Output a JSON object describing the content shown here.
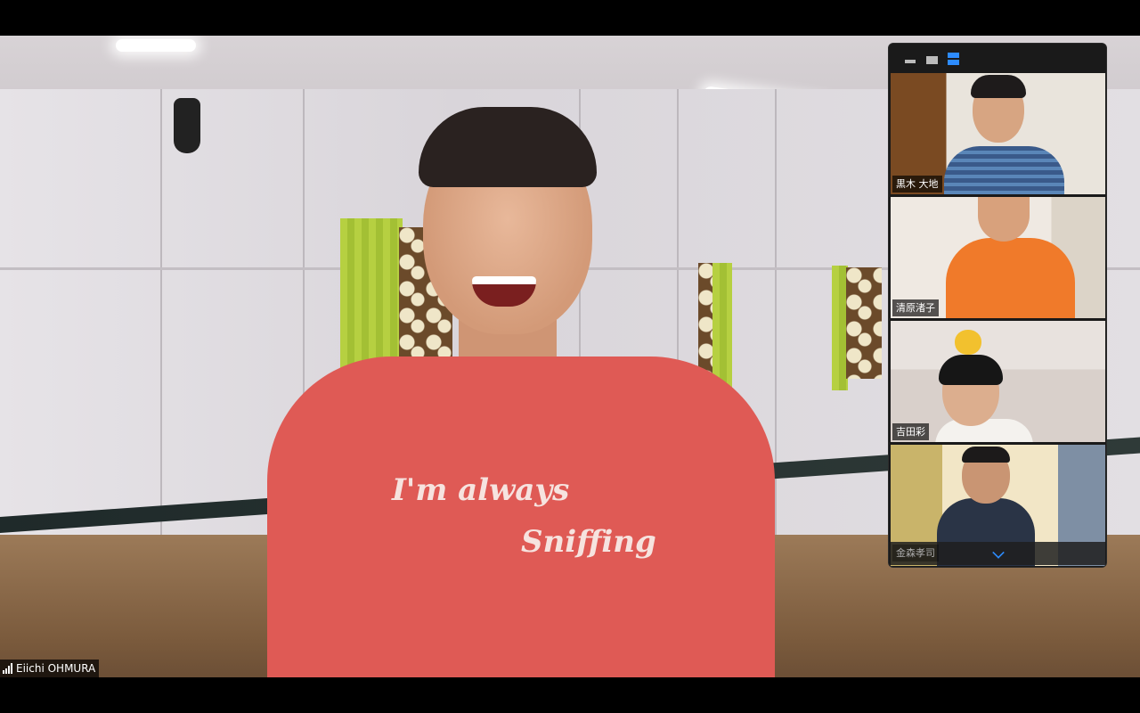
{
  "meeting": {
    "active_speaker": {
      "name": "Eiichi OHMURA",
      "shirt_text_line1": "I'm always",
      "shirt_text_line2": "Sniffing",
      "connection_icon": "signal-bars-icon"
    },
    "gallery": {
      "view_controls": [
        {
          "id": "minimize",
          "icon": "minimize-icon"
        },
        {
          "id": "strip",
          "icon": "strip-view-icon"
        },
        {
          "id": "gallery",
          "icon": "gallery-view-icon",
          "active": true
        }
      ],
      "participants": [
        {
          "name": "黒木 大地"
        },
        {
          "name": "清原渚子"
        },
        {
          "name": "吉田彩"
        },
        {
          "name": "金森孝司"
        }
      ],
      "scroll_icon": "chevron-down-icon"
    }
  },
  "colors": {
    "accent": "#2d8cff",
    "label_bg": "#000000",
    "shirt": "#df5a55"
  }
}
